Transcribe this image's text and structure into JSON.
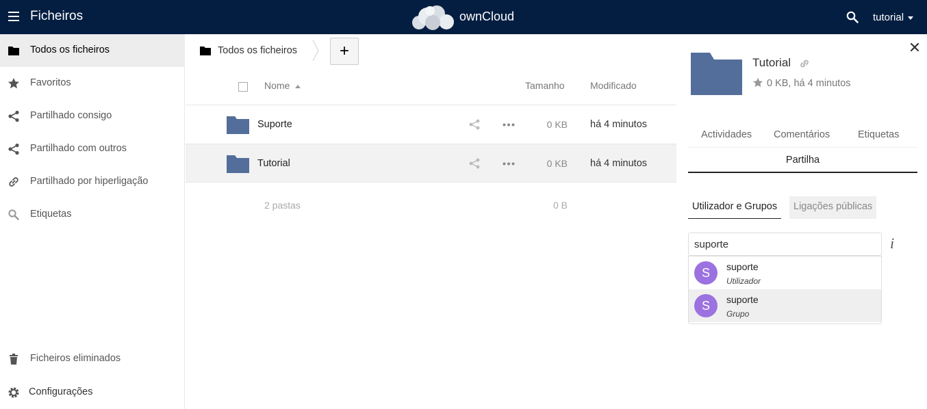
{
  "header": {
    "app_title": "Ficheiros",
    "brand": "ownCloud",
    "user": "tutorial"
  },
  "sidebar": {
    "items": [
      {
        "label": "Todos os ficheiros",
        "icon": "folder-icon",
        "active": true
      },
      {
        "label": "Favoritos",
        "icon": "star-icon"
      },
      {
        "label": "Partilhado consigo",
        "icon": "share-icon"
      },
      {
        "label": "Partilhado com outros",
        "icon": "share-icon"
      },
      {
        "label": "Partilhado por hiperligação",
        "icon": "link-icon"
      },
      {
        "label": "Etiquetas",
        "icon": "tag-search-icon"
      }
    ],
    "bottom": [
      {
        "label": "Ficheiros eliminados",
        "icon": "trash-icon"
      },
      {
        "label": "Configurações",
        "icon": "gear-icon"
      }
    ]
  },
  "breadcrumb": {
    "label": "Todos os ficheiros",
    "new_button": "+"
  },
  "table": {
    "headers": {
      "name": "Nome",
      "size": "Tamanho",
      "modified": "Modificado"
    },
    "rows": [
      {
        "name": "Suporte",
        "size": "0 KB",
        "modified": "há 4 minutos"
      },
      {
        "name": "Tutorial",
        "size": "0 KB",
        "modified": "há 4 minutos"
      }
    ],
    "summary": {
      "label": "2 pastas",
      "size": "0 B"
    }
  },
  "panel": {
    "title": "Tutorial",
    "meta": "0 KB, há 4 minutos",
    "tabs": [
      "Actividades",
      "Comentários",
      "Etiquetas"
    ],
    "active_tab": "Partilha",
    "subtabs": {
      "active": "Utilizador e Grupos",
      "inactive": "Ligações públicas"
    },
    "input_value": "suporte",
    "info_glyph": "i",
    "suggestions": [
      {
        "initial": "S",
        "name": "suporte",
        "type": "Utilizador"
      },
      {
        "initial": "S",
        "name": "suporte",
        "type": "Grupo"
      }
    ]
  },
  "colors": {
    "header_bg": "#041e42",
    "folder": "#536e9b",
    "avatar": "#9b72e0"
  }
}
